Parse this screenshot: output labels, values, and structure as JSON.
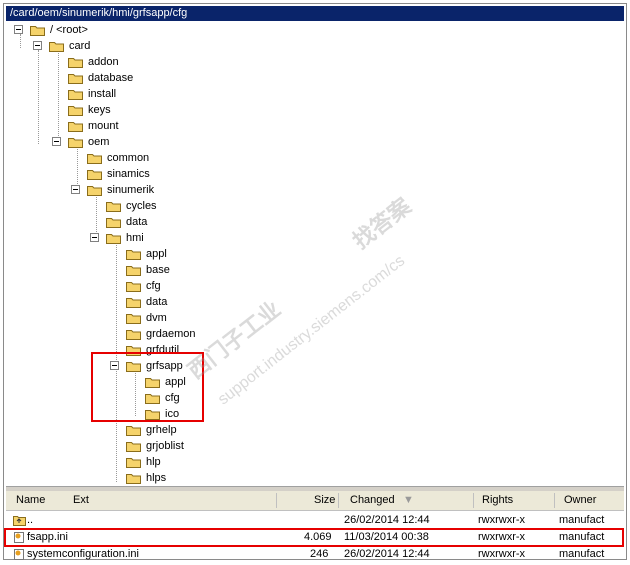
{
  "path": "/card/oem/sinumerik/hmi/grfsapp/cfg",
  "tree": {
    "root": "/ <root>",
    "card": "card",
    "card_children": [
      "addon",
      "database",
      "install",
      "keys",
      "mount"
    ],
    "oem": "oem",
    "oem_children": [
      "common",
      "sinamics"
    ],
    "sinumerik": "sinumerik",
    "sinumerik_children": [
      "cycles",
      "data"
    ],
    "hmi": "hmi",
    "hmi_children": [
      "appl",
      "base",
      "cfg",
      "data",
      "dvm",
      "grdaemon",
      "grfdutil"
    ],
    "grfsapp": "grfsapp",
    "grfsapp_children": [
      "appl",
      "cfg",
      "ico"
    ],
    "hmi_children_after": [
      "grhelp",
      "grjoblist",
      "hlp",
      "hlps"
    ]
  },
  "watermark": {
    "text1": "西门子工业",
    "text2": "support.industry.siemens.com/cs",
    "text3": "找答案"
  },
  "list": {
    "columns": {
      "name": "Name",
      "ext": "Ext",
      "size": "Size",
      "changed": "Changed",
      "rights": "Rights",
      "owner": "Owner"
    },
    "rows": [
      {
        "name": "..",
        "size": "",
        "changed": "26/02/2014 12:44",
        "rights": "rwxrwxr-x",
        "owner": "manufact"
      },
      {
        "name": "fsapp.ini",
        "size": "4.069",
        "changed": "11/03/2014 00:38",
        "rights": "rwxrwxr-x",
        "owner": "manufact"
      },
      {
        "name": "systemconfiguration.ini",
        "size": "246",
        "changed": "26/02/2014 12:44",
        "rights": "rwxrwxr-x",
        "owner": "manufact"
      }
    ]
  },
  "colors": {
    "pathbar": "#0a246a",
    "highlight": "#e60000",
    "folder": "#f5d36b"
  }
}
